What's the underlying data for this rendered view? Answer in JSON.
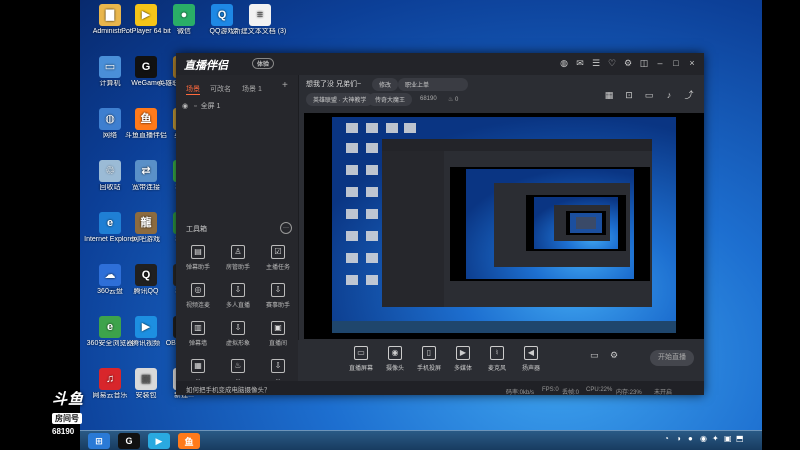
{
  "desktop": {
    "icons": [
      {
        "label": "Administr...",
        "icon": "folder-icon",
        "color": "#e9b64c",
        "glyph": "▇"
      },
      {
        "label": "PotPlayer 64 bit",
        "icon": "potplayer-icon",
        "color": "#f5c518",
        "glyph": "▶"
      },
      {
        "label": "微信",
        "icon": "wechat-icon",
        "color": "#2aae67",
        "glyph": "●"
      },
      {
        "label": "QQ游戏",
        "icon": "qq-game-icon",
        "color": "#1e88e5",
        "glyph": "Q"
      },
      {
        "label": "新建文本文档 (3)",
        "icon": "text-document-icon",
        "color": "#f2f2f2",
        "glyph": "≡"
      },
      {
        "label": "计算机",
        "icon": "computer-icon",
        "color": "#4a8fd8",
        "glyph": "▭"
      },
      {
        "label": "WeGame",
        "icon": "wegame-icon",
        "color": "#111111",
        "glyph": "G"
      },
      {
        "label": "英雄联盟 WeG...",
        "icon": "league-icon",
        "color": "#b88a2f",
        "glyph": "L"
      },
      {
        "label": "网络",
        "icon": "network-icon",
        "color": "#3e7fd0",
        "glyph": "◍"
      },
      {
        "label": "斗鱼直播伴侣",
        "icon": "douyu-icon",
        "color": "#ff7a1a",
        "glyph": "鱼"
      },
      {
        "label": "英雄...",
        "icon": "hero-icon",
        "color": "#c9a13b",
        "glyph": "H"
      },
      {
        "label": "回收站",
        "icon": "recycle-bin-icon",
        "color": "#9bbbd6",
        "glyph": "♲"
      },
      {
        "label": "宽带连接",
        "icon": "broadband-icon",
        "color": "#5a90c8",
        "glyph": "⇄"
      },
      {
        "label": "360...",
        "icon": "shield-360-icon",
        "color": "#3bb54a",
        "glyph": "3"
      },
      {
        "label": "Internet Explorer",
        "icon": "ie-icon",
        "color": "#1f7fd4",
        "glyph": "e"
      },
      {
        "label": "网吧游戏",
        "icon": "game-icon",
        "color": "#8c6b3f",
        "glyph": "龍"
      },
      {
        "label": "360...",
        "icon": "safe-360-icon",
        "color": "#2f9e44",
        "glyph": "3"
      },
      {
        "label": "360云盘",
        "icon": "cloud-360-icon",
        "color": "#2e6fd8",
        "glyph": "☁"
      },
      {
        "label": "腾讯QQ",
        "icon": "qq-icon",
        "color": "#202020",
        "glyph": "Q"
      },
      {
        "label": "360...",
        "icon": "tool-360-icon",
        "color": "#2b2b2b",
        "glyph": "▤"
      },
      {
        "label": "360安全浏览器",
        "icon": "browser-360-icon",
        "color": "#3da34b",
        "glyph": "e"
      },
      {
        "label": "腾讯视频",
        "icon": "tencent-video-icon",
        "color": "#1d8fe1",
        "glyph": "▶"
      },
      {
        "label": "OBS Studio",
        "icon": "obs-icon",
        "color": "#222222",
        "glyph": "◉"
      },
      {
        "label": "网易云音乐",
        "icon": "netease-music-icon",
        "color": "#d8262b",
        "glyph": "♫"
      },
      {
        "label": "安装包",
        "icon": "installer-icon",
        "color": "#d9d9d9",
        "glyph": "▦"
      },
      {
        "label": "新建...",
        "icon": "new-file-icon",
        "color": "#e9e9e9",
        "glyph": "▤"
      }
    ]
  },
  "watermark": {
    "logo": "斗鱼",
    "room_label": "房间号",
    "room_number": "68190"
  },
  "taskbar": {
    "items": [
      {
        "icon": "start-orb-icon",
        "glyph": "⊞",
        "color": "#2a7ad6"
      },
      {
        "icon": "wegame-taskbar-icon",
        "glyph": "G",
        "color": "#111111"
      },
      {
        "icon": "video-taskbar-icon",
        "glyph": "▶",
        "color": "#2aa9e0"
      },
      {
        "icon": "douyu-taskbar-icon",
        "glyph": "鱼",
        "color": "#ff7a1a"
      }
    ],
    "tray": [
      "◔",
      "◑",
      "●",
      "◉",
      "✦",
      "▣",
      "⬒"
    ]
  },
  "app": {
    "title": "直播伴侣",
    "badge": "体验",
    "title_icons": [
      "avatar-icon",
      "message-icon",
      "chat-icon",
      "gift-icon",
      "settings-icon",
      "skin-icon",
      "minimize-icon",
      "maximize-icon",
      "close-icon"
    ],
    "title_glyphs": [
      "◍",
      "✉",
      "☰",
      "♡",
      "⚙",
      "◫",
      "–",
      "□",
      "×"
    ],
    "sidebar": {
      "tabs": [
        "场景",
        "可改名",
        "场景 1",
        "+"
      ],
      "scene_item": "全屏 1",
      "tools_title": "工具箱",
      "tools": [
        {
          "label": "弹幕助手",
          "icon": "danmu-icon",
          "glyph": "▤"
        },
        {
          "label": "房管助手",
          "icon": "manager-icon",
          "glyph": "♙"
        },
        {
          "label": "主播任务",
          "icon": "task-icon",
          "glyph": "☑"
        },
        {
          "label": "视频连麦",
          "icon": "video-call-icon",
          "glyph": "◎"
        },
        {
          "label": "多人直播",
          "icon": "multi-live-icon",
          "glyph": "⇩"
        },
        {
          "label": "赛事助手",
          "icon": "match-icon",
          "glyph": "⇩"
        },
        {
          "label": "弹幕墙",
          "icon": "barrage-wall-icon",
          "glyph": "▥"
        },
        {
          "label": "虚拟形象",
          "icon": "avatar-virtual-icon",
          "glyph": "⇩"
        },
        {
          "label": "直播间",
          "icon": "live-room-icon",
          "glyph": "▣"
        },
        {
          "label": "...",
          "icon": "more-tool-icon",
          "glyph": "▦"
        },
        {
          "label": "...",
          "icon": "more-tool-2-icon",
          "glyph": "♨"
        },
        {
          "label": "...",
          "icon": "more-tool-3-icon",
          "glyph": "⇩"
        }
      ]
    },
    "header": {
      "title": "想我了没 兄弟们~",
      "edit_pill": "修改",
      "category_pill": "职业上单",
      "game_pill": "英雄联盟 · 大神教学",
      "rank_pill": "传奇大魔王",
      "room_number": "68190",
      "hot": "0",
      "right_icons": [
        "layout-icon",
        "lock-icon",
        "screen-icon",
        "bell-icon",
        "share-icon"
      ],
      "right_glyphs": [
        "▦",
        "⊡",
        "▭",
        "♪",
        "⤴"
      ]
    },
    "controls": [
      {
        "label": "直播屏幕",
        "icon": "screen-capture-icon",
        "glyph": "▭"
      },
      {
        "label": "摄像头",
        "icon": "camera-icon",
        "glyph": "◉"
      },
      {
        "label": "手机投屏",
        "icon": "phone-cast-icon",
        "glyph": "▯"
      },
      {
        "label": "多媒体",
        "icon": "media-icon",
        "glyph": "▶"
      },
      {
        "label": "麦克风",
        "icon": "microphone-icon",
        "glyph": "♮"
      },
      {
        "label": "扬声器",
        "icon": "speaker-icon",
        "glyph": "◀"
      }
    ],
    "go_live": "开始直播",
    "hint": "如何把手机变成电脑摄像头？",
    "stats": {
      "bitrate": "码率:0kb/s",
      "fps": "FPS:0",
      "dropped": "丢帧:0",
      "cpu": "CPU:22%",
      "mem": "内存:23%",
      "status": "未开启"
    }
  }
}
